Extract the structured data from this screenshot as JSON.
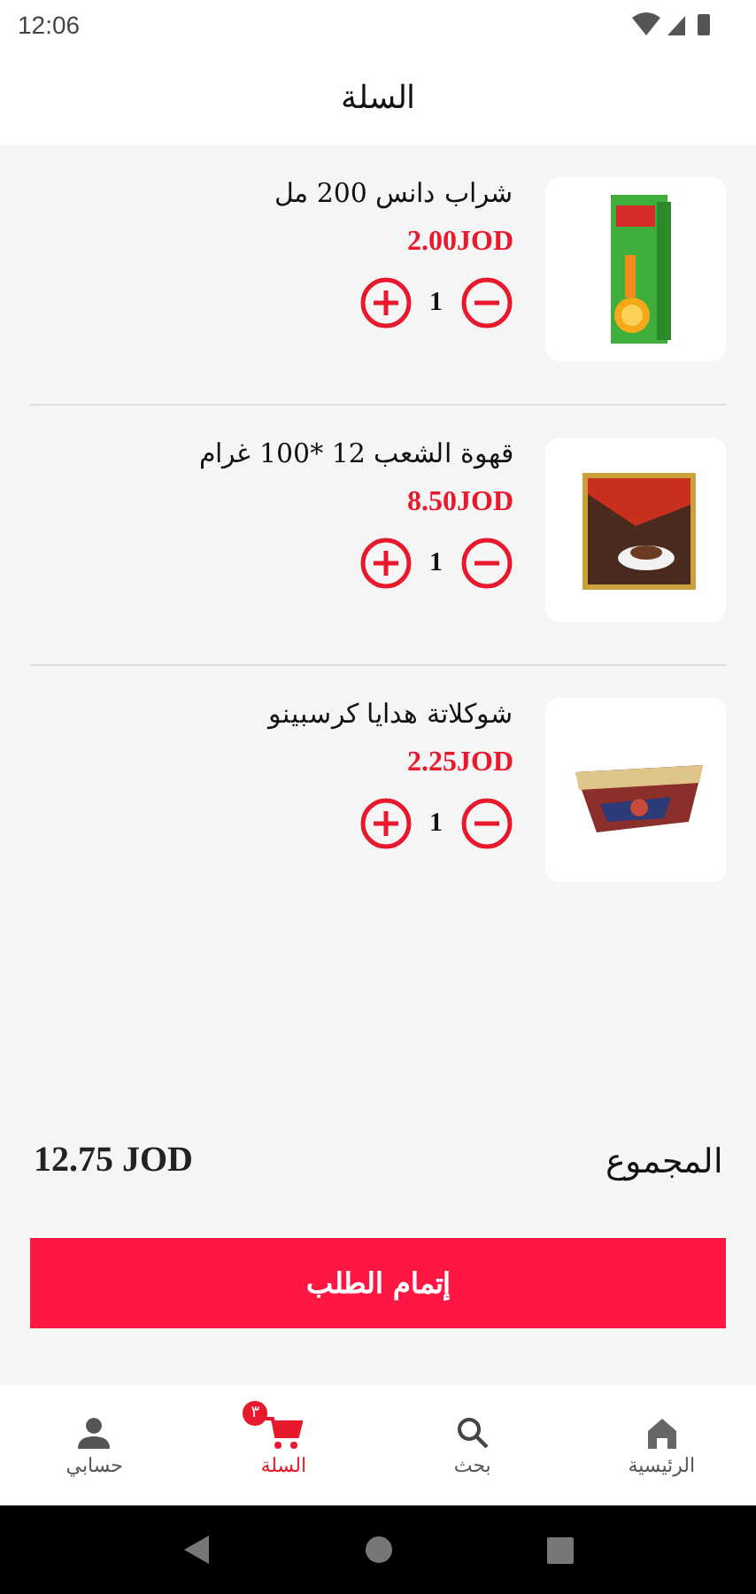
{
  "status_bar": {
    "time": "12:06"
  },
  "header": {
    "title": "السلة"
  },
  "items": [
    {
      "name": "شراب دانس 200 مل",
      "price": "2.00JOD",
      "quantity": "1"
    },
    {
      "name": "قهوة الشعب 12 *100 غرام",
      "price": "8.50JOD",
      "quantity": "1"
    },
    {
      "name": "شوكلاتة هدايا كرسبينو",
      "price": "2.25JOD",
      "quantity": "1"
    }
  ],
  "total": {
    "label": "المجموع",
    "value": "12.75 JOD"
  },
  "checkout_button": "إتمام الطلب",
  "bottom_nav": [
    {
      "label": "الرئيسية",
      "kind": "home",
      "selected": false
    },
    {
      "label": "بحث",
      "kind": "search",
      "selected": false
    },
    {
      "label": "السلة",
      "kind": "cart",
      "selected": true,
      "badge": "٣"
    },
    {
      "label": "حسابي",
      "kind": "person",
      "selected": false
    }
  ]
}
